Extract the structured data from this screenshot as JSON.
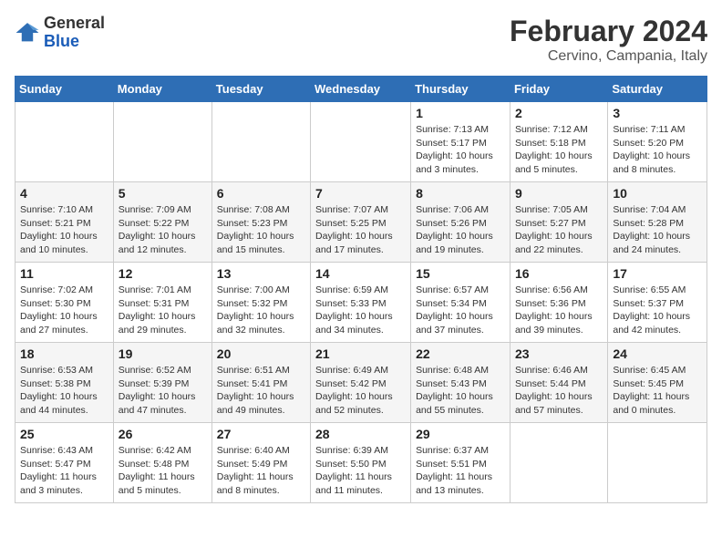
{
  "header": {
    "logo_line1": "General",
    "logo_line2": "Blue",
    "month": "February 2024",
    "location": "Cervino, Campania, Italy"
  },
  "weekdays": [
    "Sunday",
    "Monday",
    "Tuesday",
    "Wednesday",
    "Thursday",
    "Friday",
    "Saturday"
  ],
  "weeks": [
    [
      {
        "day": "",
        "info": ""
      },
      {
        "day": "",
        "info": ""
      },
      {
        "day": "",
        "info": ""
      },
      {
        "day": "",
        "info": ""
      },
      {
        "day": "1",
        "info": "Sunrise: 7:13 AM\nSunset: 5:17 PM\nDaylight: 10 hours\nand 3 minutes."
      },
      {
        "day": "2",
        "info": "Sunrise: 7:12 AM\nSunset: 5:18 PM\nDaylight: 10 hours\nand 5 minutes."
      },
      {
        "day": "3",
        "info": "Sunrise: 7:11 AM\nSunset: 5:20 PM\nDaylight: 10 hours\nand 8 minutes."
      }
    ],
    [
      {
        "day": "4",
        "info": "Sunrise: 7:10 AM\nSunset: 5:21 PM\nDaylight: 10 hours\nand 10 minutes."
      },
      {
        "day": "5",
        "info": "Sunrise: 7:09 AM\nSunset: 5:22 PM\nDaylight: 10 hours\nand 12 minutes."
      },
      {
        "day": "6",
        "info": "Sunrise: 7:08 AM\nSunset: 5:23 PM\nDaylight: 10 hours\nand 15 minutes."
      },
      {
        "day": "7",
        "info": "Sunrise: 7:07 AM\nSunset: 5:25 PM\nDaylight: 10 hours\nand 17 minutes."
      },
      {
        "day": "8",
        "info": "Sunrise: 7:06 AM\nSunset: 5:26 PM\nDaylight: 10 hours\nand 19 minutes."
      },
      {
        "day": "9",
        "info": "Sunrise: 7:05 AM\nSunset: 5:27 PM\nDaylight: 10 hours\nand 22 minutes."
      },
      {
        "day": "10",
        "info": "Sunrise: 7:04 AM\nSunset: 5:28 PM\nDaylight: 10 hours\nand 24 minutes."
      }
    ],
    [
      {
        "day": "11",
        "info": "Sunrise: 7:02 AM\nSunset: 5:30 PM\nDaylight: 10 hours\nand 27 minutes."
      },
      {
        "day": "12",
        "info": "Sunrise: 7:01 AM\nSunset: 5:31 PM\nDaylight: 10 hours\nand 29 minutes."
      },
      {
        "day": "13",
        "info": "Sunrise: 7:00 AM\nSunset: 5:32 PM\nDaylight: 10 hours\nand 32 minutes."
      },
      {
        "day": "14",
        "info": "Sunrise: 6:59 AM\nSunset: 5:33 PM\nDaylight: 10 hours\nand 34 minutes."
      },
      {
        "day": "15",
        "info": "Sunrise: 6:57 AM\nSunset: 5:34 PM\nDaylight: 10 hours\nand 37 minutes."
      },
      {
        "day": "16",
        "info": "Sunrise: 6:56 AM\nSunset: 5:36 PM\nDaylight: 10 hours\nand 39 minutes."
      },
      {
        "day": "17",
        "info": "Sunrise: 6:55 AM\nSunset: 5:37 PM\nDaylight: 10 hours\nand 42 minutes."
      }
    ],
    [
      {
        "day": "18",
        "info": "Sunrise: 6:53 AM\nSunset: 5:38 PM\nDaylight: 10 hours\nand 44 minutes."
      },
      {
        "day": "19",
        "info": "Sunrise: 6:52 AM\nSunset: 5:39 PM\nDaylight: 10 hours\nand 47 minutes."
      },
      {
        "day": "20",
        "info": "Sunrise: 6:51 AM\nSunset: 5:41 PM\nDaylight: 10 hours\nand 49 minutes."
      },
      {
        "day": "21",
        "info": "Sunrise: 6:49 AM\nSunset: 5:42 PM\nDaylight: 10 hours\nand 52 minutes."
      },
      {
        "day": "22",
        "info": "Sunrise: 6:48 AM\nSunset: 5:43 PM\nDaylight: 10 hours\nand 55 minutes."
      },
      {
        "day": "23",
        "info": "Sunrise: 6:46 AM\nSunset: 5:44 PM\nDaylight: 10 hours\nand 57 minutes."
      },
      {
        "day": "24",
        "info": "Sunrise: 6:45 AM\nSunset: 5:45 PM\nDaylight: 11 hours\nand 0 minutes."
      }
    ],
    [
      {
        "day": "25",
        "info": "Sunrise: 6:43 AM\nSunset: 5:47 PM\nDaylight: 11 hours\nand 3 minutes."
      },
      {
        "day": "26",
        "info": "Sunrise: 6:42 AM\nSunset: 5:48 PM\nDaylight: 11 hours\nand 5 minutes."
      },
      {
        "day": "27",
        "info": "Sunrise: 6:40 AM\nSunset: 5:49 PM\nDaylight: 11 hours\nand 8 minutes."
      },
      {
        "day": "28",
        "info": "Sunrise: 6:39 AM\nSunset: 5:50 PM\nDaylight: 11 hours\nand 11 minutes."
      },
      {
        "day": "29",
        "info": "Sunrise: 6:37 AM\nSunset: 5:51 PM\nDaylight: 11 hours\nand 13 minutes."
      },
      {
        "day": "",
        "info": ""
      },
      {
        "day": "",
        "info": ""
      }
    ]
  ]
}
